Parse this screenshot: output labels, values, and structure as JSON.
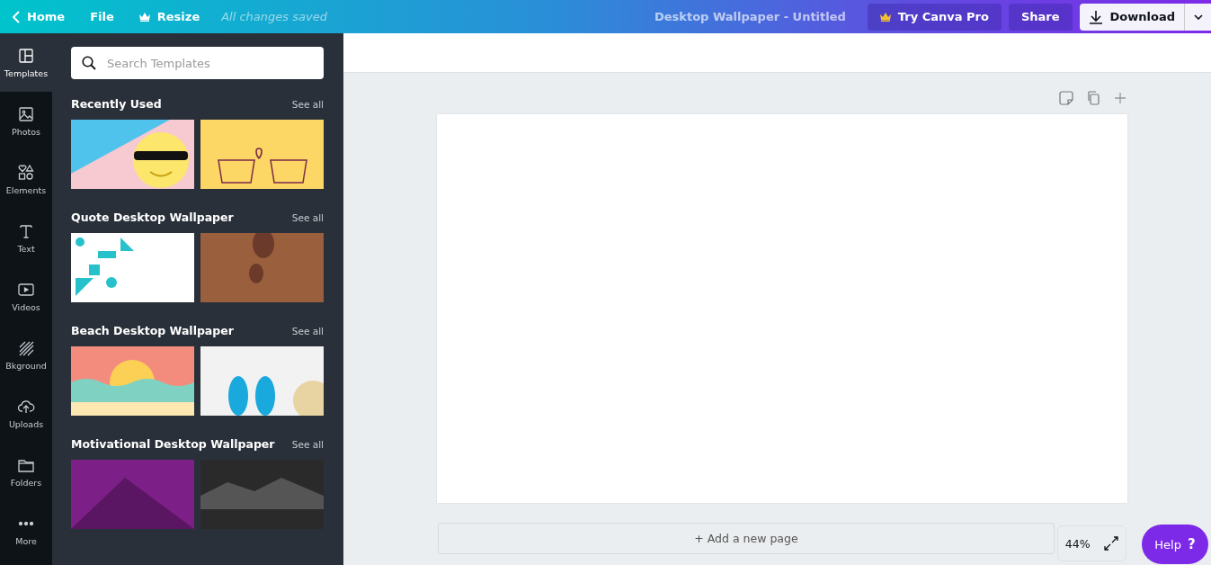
{
  "topbar": {
    "back": "Home",
    "menu": [
      "File",
      "Resize"
    ],
    "save_status": "All changes saved",
    "document_title": "Desktop Wallpaper - Untitled",
    "pro_button": "Try Canva Pro",
    "share_button": "Share",
    "download_button": "Download"
  },
  "sidebar": {
    "items": [
      {
        "kind": "templates",
        "label": "Templates",
        "selected": true
      },
      {
        "kind": "photos",
        "label": "Photos",
        "selected": false
      },
      {
        "kind": "elements",
        "label": "Elements",
        "selected": false
      },
      {
        "kind": "text",
        "label": "Text",
        "selected": false
      },
      {
        "kind": "videos",
        "label": "Videos",
        "selected": false
      },
      {
        "kind": "background",
        "label": "Bkground",
        "selected": false
      },
      {
        "kind": "uploads",
        "label": "Uploads",
        "selected": false
      },
      {
        "kind": "folders",
        "label": "Folders",
        "selected": false
      },
      {
        "kind": "more",
        "label": "More",
        "selected": false
      }
    ]
  },
  "panel": {
    "search": {
      "placeholder": "Search Templates"
    },
    "sections": [
      {
        "title": "Recently Used",
        "see_all": "See all",
        "templates": [
          {
            "color": "#4fc3ec"
          },
          {
            "color": "#fcd766"
          }
        ]
      },
      {
        "title": "Quote Desktop Wallpaper",
        "see_all": "See all",
        "templates": [
          {
            "color": "#ffffff"
          },
          {
            "color": "#9a5f3c"
          }
        ]
      },
      {
        "title": "Beach Desktop Wallpaper",
        "see_all": "See all",
        "templates": [
          {
            "color": "#f48c7d"
          },
          {
            "color": "#f2f2f2"
          }
        ]
      },
      {
        "title": "Motivational Desktop Wallpaper",
        "see_all": "See all",
        "templates": [
          {
            "color": "#7c1f86"
          },
          {
            "color": "#2a2a2a"
          }
        ]
      }
    ]
  },
  "workspace": {
    "add_page": "+ Add a new page",
    "zoom": "44%",
    "help": "Help",
    "help_mark": "?"
  }
}
